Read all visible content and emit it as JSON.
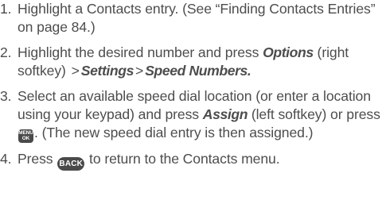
{
  "steps": [
    {
      "num": "1.",
      "parts": [
        "Highlight a Contacts entry. (See “Finding Contacts Entries” on page 84.)"
      ]
    },
    {
      "num": "2.",
      "parts": [
        "Highlight the desired number and press ",
        "Options",
        " (right softkey) ",
        ">",
        "Settings",
        ">",
        "Speed Numbers."
      ]
    },
    {
      "num": "3.",
      "parts": [
        "Select an available speed dial location (or enter a location using your keypad) and press ",
        "Assign",
        " (left softkey) or press ",
        ". (The new speed dial entry is then assigned.)"
      ]
    },
    {
      "num": "4.",
      "parts": [
        "Press ",
        " to return to the Contacts menu."
      ]
    }
  ],
  "keys": {
    "menu_ok_top": "MENU",
    "menu_ok_bottom": "OK",
    "back": "BACK"
  },
  "colors": {
    "text": "#4d4d4d",
    "key_background": "#4a4a4a",
    "key_text": "#ffffff"
  }
}
